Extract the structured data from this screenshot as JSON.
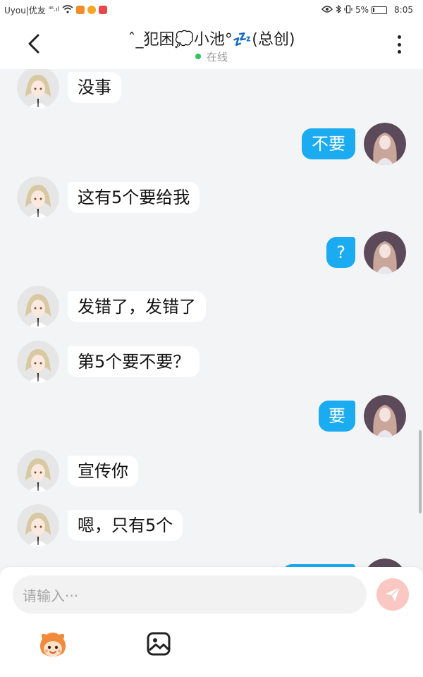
{
  "status_bar": {
    "carrier": "Uyou|优友",
    "signal": "⁴⁶.ıl",
    "battery": "5%",
    "time": "8:05"
  },
  "header": {
    "title": "ˆ_犯困💭小池°💤(总创)",
    "status": "在线"
  },
  "messages": [
    {
      "side": "left",
      "text": "没事"
    },
    {
      "side": "right",
      "text": "不要"
    },
    {
      "side": "left",
      "text": "这有5个要给我"
    },
    {
      "side": "right",
      "text": "?"
    },
    {
      "side": "left",
      "text": "发错了，发错了"
    },
    {
      "side": "left",
      "text": "第5个要不要？"
    },
    {
      "side": "right",
      "text": "要"
    },
    {
      "side": "left",
      "text": "宣传你"
    },
    {
      "side": "left",
      "text": "嗯，只有5个"
    },
    {
      "side": "right",
      "text": ""
    }
  ],
  "input": {
    "placeholder": "请输入···"
  },
  "colors": {
    "outgoing_bubble": "#1aabf0",
    "incoming_bubble": "#ffffff",
    "online": "#2ec55b",
    "send_button": "#fbc7c2"
  },
  "icons": {
    "back": "chevron-left-icon",
    "more": "more-vertical-icon",
    "send": "send-icon",
    "sticker": "sticker-mascot-icon",
    "image": "image-icon"
  }
}
